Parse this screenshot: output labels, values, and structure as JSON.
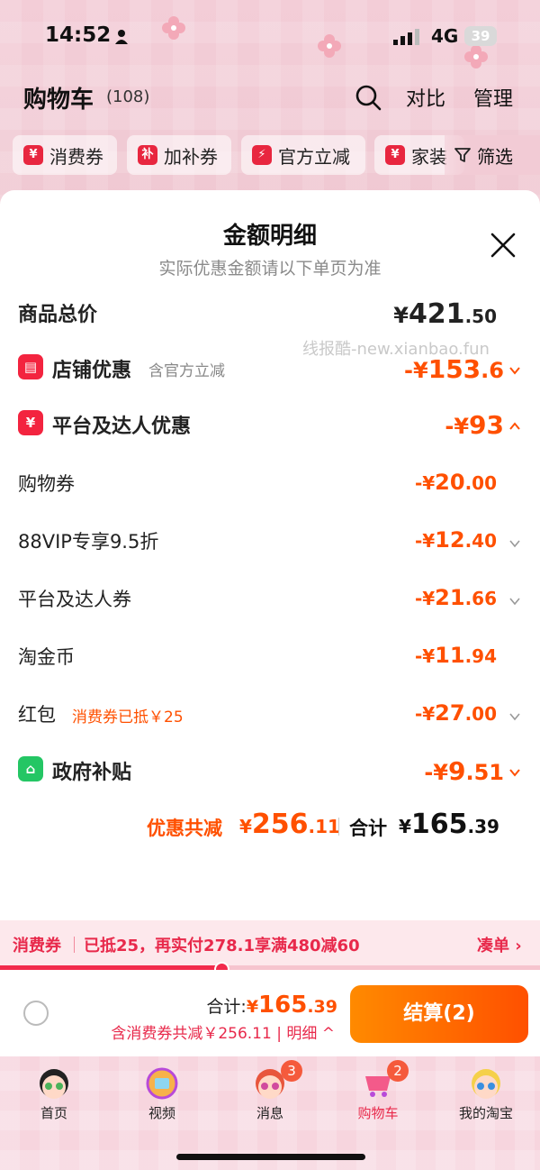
{
  "status_bar": {
    "time": "14:52",
    "network": "4G",
    "battery": "39"
  },
  "header": {
    "title": "购物车",
    "count": "(108)",
    "compare": "对比",
    "manage": "管理"
  },
  "chips": [
    {
      "icon": "¥",
      "label": "消费券"
    },
    {
      "icon": "补",
      "label": "加补券"
    },
    {
      "icon": "⚡",
      "label": "官方立减"
    },
    {
      "icon": "¥",
      "label": "家装"
    }
  ],
  "filter_label": "筛选",
  "sheet": {
    "title": "金额明细",
    "subtitle": "实际优惠金额请以下单页为准",
    "watermark": "线报酷-new.xianbao.fun",
    "total": {
      "label": "商品总价",
      "symbol": "¥",
      "int": "421",
      "dec": ".50"
    },
    "shop": {
      "label": "店铺优惠",
      "note": "含官方立减",
      "symbol": "-¥",
      "int": "153",
      "dec": ".6"
    },
    "platform": {
      "label": "平台及达人优惠",
      "symbol": "-¥",
      "int": "93",
      "dec": ""
    },
    "items": [
      {
        "label": "购物券",
        "symbol": "-¥",
        "int": "20",
        "dec": ".00"
      },
      {
        "label": "88VIP专享9.5折",
        "symbol": "-¥",
        "int": "12",
        "dec": ".40"
      },
      {
        "label": "平台及达人券",
        "symbol": "-¥",
        "int": "21",
        "dec": ".66"
      },
      {
        "label": "淘金币",
        "symbol": "-¥",
        "int": "11",
        "dec": ".94"
      },
      {
        "label": "红包",
        "note": "消费券已抵￥25",
        "symbol": "-¥",
        "int": "27",
        "dec": ".00"
      }
    ],
    "gov": {
      "label": "政府补贴",
      "symbol": "-¥",
      "int": "9",
      "dec": ".51"
    },
    "summary": {
      "discount_label": "优惠共减",
      "discount_symbol": "¥",
      "discount_int": "256",
      "discount_dec": ".11",
      "total_label": "合计",
      "total_symbol": "¥",
      "total_int": "165",
      "total_dec": ".39"
    }
  },
  "coupon_bar": {
    "label": "消费券",
    "text": "已抵25，再实付278.1享满480减60",
    "action": "凑单 ›",
    "progress": 0.41
  },
  "checkout": {
    "total_label": "合计:",
    "total_symbol": "¥",
    "total_int": "165",
    "total_dec": ".39",
    "detail_text": "含消费券共减￥256.11 | 明细 ^",
    "pay_label": "结算(2)"
  },
  "tabs": [
    {
      "label": "首页"
    },
    {
      "label": "视频"
    },
    {
      "label": "消息",
      "badge": "3"
    },
    {
      "label": "购物车",
      "badge": "2"
    },
    {
      "label": "我的淘宝"
    }
  ],
  "colors": {
    "accent": "#ff5000",
    "brand_red": "#f3243f",
    "coupon_red": "#e8294b",
    "green": "#24c664"
  }
}
